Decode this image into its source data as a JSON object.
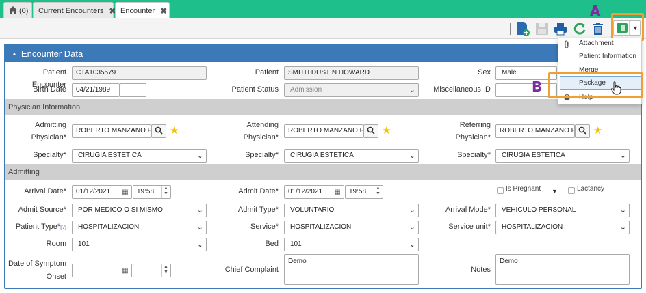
{
  "tabs": [
    {
      "label": "(0)"
    },
    {
      "label": "Current Encounters"
    },
    {
      "label": "Encounter"
    }
  ],
  "panel": {
    "title": "Encounter Data"
  },
  "fields": {
    "patient_encounter_label": "Patient Encounter",
    "patient_encounter": "CTA1035579",
    "patient_label": "Patient",
    "patient": "SMITH DUSTIN HOWARD",
    "sex_label": "Sex",
    "sex": "Male",
    "birth_date_label": "Birth Date",
    "birth_date": "04/21/1989",
    "patient_status_label": "Patient Status",
    "patient_status": "Admission",
    "misc_id_label": "Miscellaneous ID"
  },
  "physician": {
    "section": "Physician Information",
    "admitting_label": "Admitting",
    "admitting_label2": "Physician*",
    "admitting": "ROBERTO MANZANO FL",
    "attending_label": "Attending",
    "attending_label2": "Physician*",
    "attending": "ROBERTO MANZANO FL",
    "referring_label": "Referring",
    "referring_label2": "Physician*",
    "referring": "ROBERTO MANZANO FL",
    "specialty_label": "Specialty*",
    "specialty1": "CIRUGIA ESTETICA",
    "specialty2": "CIRUGIA ESTETICA",
    "specialty3": "CIRUGIA ESTETICA"
  },
  "admitting": {
    "section": "Admitting",
    "arrival_date_label": "Arrival Date*",
    "arrival_date": "01/12/2021",
    "arrival_time": "19:58",
    "admit_date_label": "Admit Date*",
    "admit_date": "01/12/2021",
    "admit_time": "19:58",
    "is_pregnant": "Is Pregnant",
    "lactancy": "Lactancy",
    "admit_source_label": "Admit Source*",
    "admit_source": "POR MEDICO O SI MISMO",
    "admit_type_label": "Admit Type*",
    "admit_type": "VOLUNTARIO",
    "arrival_mode_label": "Arrival Mode*",
    "arrival_mode": "VEHICULO PERSONAL",
    "patient_type_label": "Patient Type*",
    "patient_type_help": "[?]",
    "patient_type": "HOSPITALIZACION",
    "service_label": "Service*",
    "service": "HOSPITALIZACION",
    "service_unit_label": "Service unit*",
    "service_unit": "HOSPITALIZACION",
    "room_label": "Room",
    "room": "101",
    "bed_label": "Bed",
    "bed": "101",
    "symptom_label1": "Date of Symptom",
    "symptom_label2": "Onset",
    "chief_complaint_label": "Chief Complaint",
    "chief_complaint": "Demo",
    "notes_label": "Notes",
    "notes": "Demo"
  },
  "menu": {
    "items": [
      "Attachment",
      "Patient Information",
      "Merge",
      "Package",
      "Help"
    ]
  },
  "markers": {
    "a": "A",
    "b": "B"
  },
  "colors": {
    "topbar": "#1fbf8b",
    "panel_header": "#3b79b9",
    "highlight": "#f0a030",
    "marker": "#7b2c9e"
  }
}
